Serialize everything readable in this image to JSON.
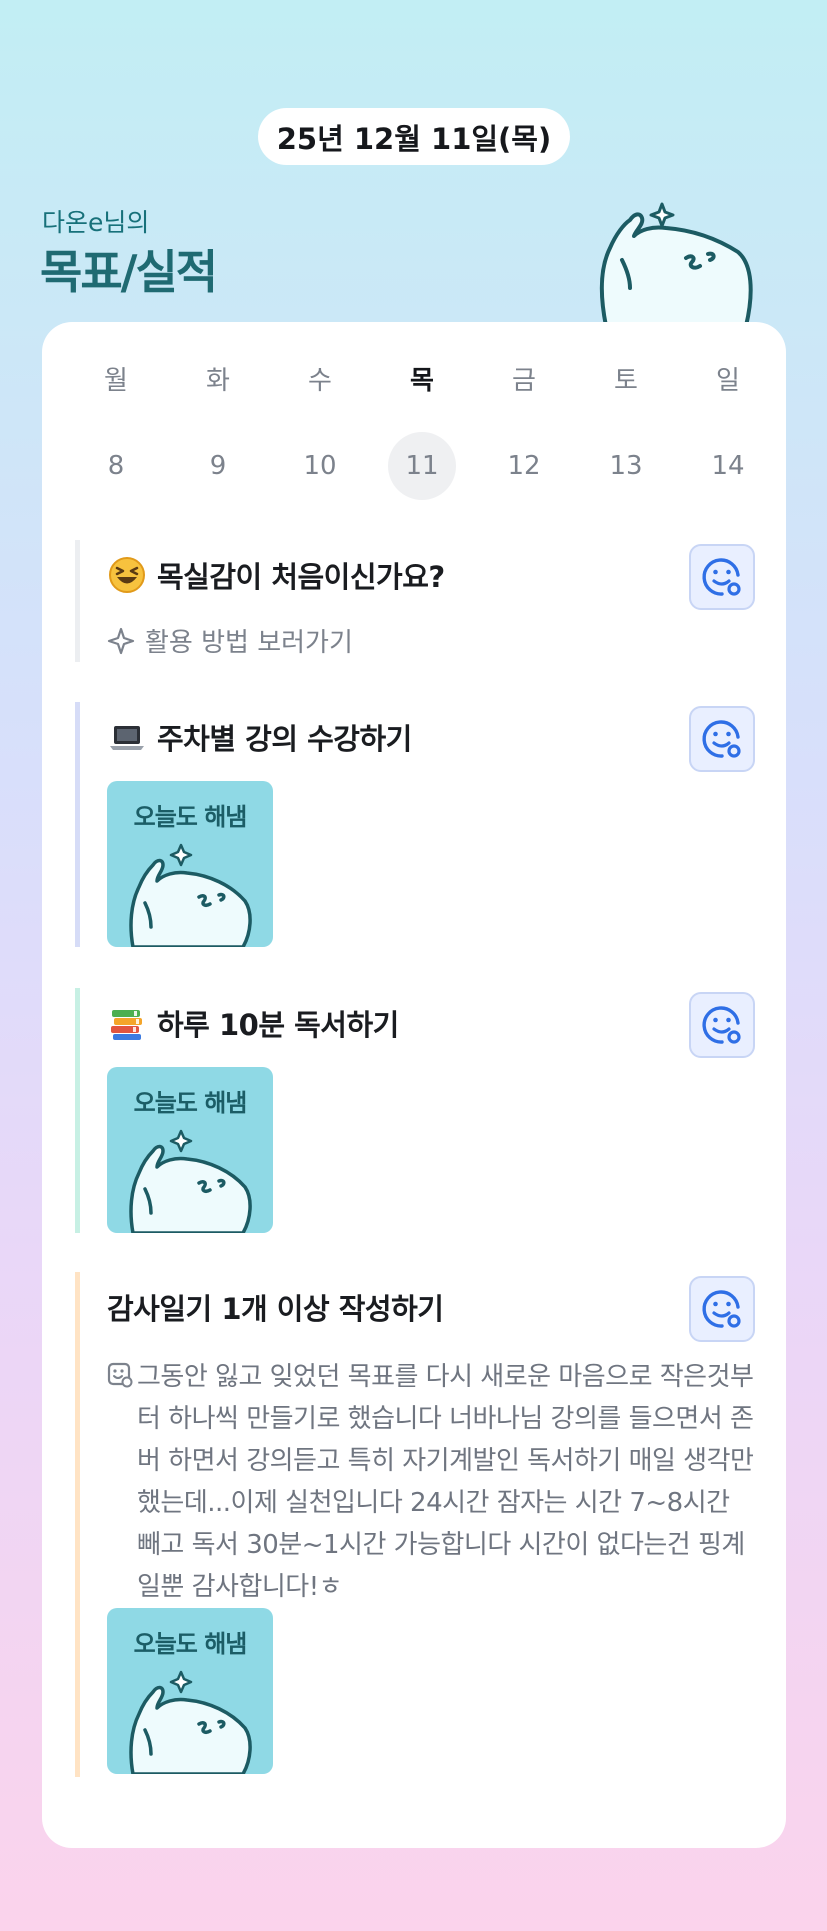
{
  "header": {
    "date": "25년 12월 11일(목)",
    "owner": "다온e님의",
    "title": "목표/실적"
  },
  "week": {
    "days": [
      "월",
      "화",
      "수",
      "목",
      "금",
      "토",
      "일"
    ],
    "dates": [
      "8",
      "9",
      "10",
      "11",
      "12",
      "13",
      "14"
    ],
    "selected_index": 3
  },
  "goals": [
    {
      "title": "목실감이 처음이신가요?",
      "emoji_icon": "grinning-squint-emoji",
      "link_label": "활용 방법 보러가기",
      "bar_color": "#eceef1"
    },
    {
      "title": "주차별 강의 수강하기",
      "emoji_icon": "laptop-emoji",
      "sticker": "오늘도 해냄",
      "bar_color": "#d6dcf7"
    },
    {
      "title": "하루 10분 독서하기",
      "emoji_icon": "books-emoji",
      "sticker": "오늘도 해냄",
      "bar_color": "#c7f0e4"
    },
    {
      "title": "감사일기 1개 이상 작성하기",
      "memo": "그동안 잃고 잊었던 목표를 다시 새로운 마음으로 작은것부터 하나씩 만들기로 했습니다 너바나님 강의를 들으면서 존버 하면서 강의듣고 특히 자기계발인 독서하기 매일 생각만 했는데...이제 실천입니다 24시간 잠자는 시간 7~8시간 빼고 독서 30분~1시간 가능합니다 시간이 없다는건 핑계일뿐 감사합니다!ㅎ",
      "sticker": "오늘도 해냄",
      "bar_color": "#ffe3c4"
    }
  ],
  "colors": {
    "accent": "#2f6fe6",
    "title_teal": "#1f6a72",
    "sticker_bg": "#8fd9e5"
  }
}
